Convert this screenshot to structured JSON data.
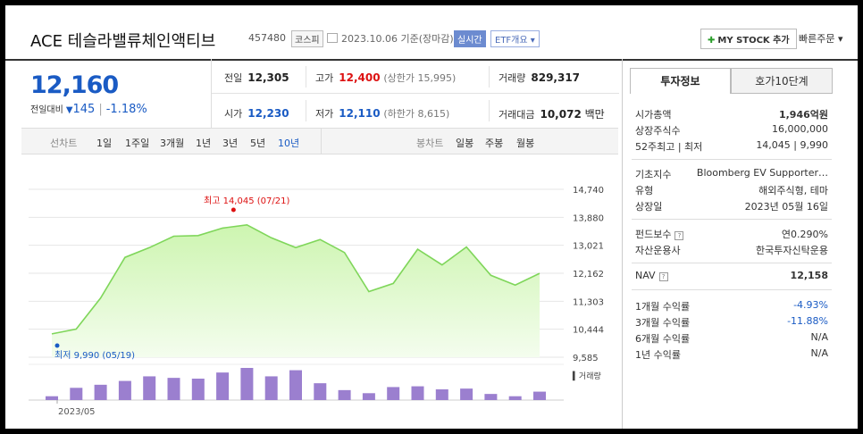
{
  "header": {
    "title": "ACE 테슬라밸류체인액티브",
    "code": "457480",
    "market": "코스피",
    "date": "2023.10.06 기준(장마감)",
    "live_label": "실시간",
    "etf_label": "ETF개요 ▾",
    "mystock_label": "MY STOCK 추가",
    "quick_order": "빠른주문 ▾"
  },
  "quote": {
    "price": "12,160",
    "diff_label": "전일대비",
    "diff_arrow": "▼",
    "diff_value": "145",
    "diff_pct": "-1.18%"
  },
  "grid": {
    "prev_label": "전일",
    "prev": "12,305",
    "high_label": "고가",
    "high": "12,400",
    "upper_limit": "(상한가 15,995)",
    "volume_label": "거래량",
    "volume": "829,317",
    "open_label": "시가",
    "open": "12,230",
    "low_label": "저가",
    "low": "12,110",
    "lower_limit": "(하한가 8,615)",
    "amount_label": "거래대금",
    "amount": "10,072",
    "amount_unit": "백만"
  },
  "period_bar": {
    "line_label": "선차트",
    "line_periods": [
      "1일",
      "1주일",
      "3개월",
      "1년",
      "3년",
      "5년",
      "10년"
    ],
    "active_line_period": "10년",
    "candle_label": "봉차트",
    "candle_periods": [
      "일봉",
      "주봉",
      "월봉"
    ]
  },
  "chart_data": {
    "type": "area",
    "x": [
      "2023-05-19",
      "2023-05-26",
      "2023-06-02",
      "2023-06-09",
      "2023-06-16",
      "2023-06-23",
      "2023-06-30",
      "2023-07-07",
      "2023-07-14",
      "2023-07-21",
      "2023-07-28",
      "2023-08-04",
      "2023-08-11",
      "2023-08-18",
      "2023-08-25",
      "2023-09-01",
      "2023-09-08",
      "2023-09-15",
      "2023-09-22",
      "2023-09-29",
      "2023-10-06"
    ],
    "values": [
      10300,
      10450,
      11400,
      12650,
      12950,
      13300,
      13320,
      13550,
      13650,
      13250,
      12950,
      13200,
      12800,
      11600,
      11850,
      12900,
      12420,
      12970,
      12100,
      11800,
      12160
    ],
    "volume": [
      50,
      160,
      200,
      250,
      310,
      290,
      280,
      360,
      420,
      310,
      390,
      220,
      130,
      90,
      170,
      180,
      140,
      150,
      80,
      50,
      110
    ],
    "yticks": [
      "14,740",
      "13,880",
      "13,021",
      "12,162",
      "11,303",
      "10,444",
      "9,585"
    ],
    "ylim": [
      9585,
      14740
    ],
    "max_label": "최고 14,045 (07/21)",
    "min_label": "최저 9,990 (05/19)",
    "volume_label": "거래량",
    "x_start_label": "2023/05",
    "colors": {
      "area": "#cdf5b0",
      "line": "#7fd65a",
      "volume": "#9b7fcf",
      "max": "#d11",
      "min": "#1a5bc4"
    }
  },
  "right_panel": {
    "tab_info": "투자정보",
    "tab_orderbook": "호가10단계",
    "rows_a": [
      {
        "label": "시가총액",
        "value": "1,946억원"
      },
      {
        "label": "상장주식수",
        "value": "16,000,000"
      },
      {
        "label": "52주최고 | 최저",
        "value": "14,045 | 9,990"
      }
    ],
    "rows_b": [
      {
        "label": "기초지수",
        "value": "Bloomberg EV Supporter…"
      },
      {
        "label": "유형",
        "value": "해외주식형, 테마"
      },
      {
        "label": "상장일",
        "value": "2023년 05월 16일"
      }
    ],
    "rows_c": [
      {
        "label": "펀드보수",
        "value": "연0.290%"
      },
      {
        "label": "자산운용사",
        "value": "한국투자신탁운용"
      }
    ],
    "nav_label": "NAV",
    "nav_value": "12,158",
    "rows_d": [
      {
        "label": "1개월 수익률",
        "value": "-4.93%"
      },
      {
        "label": "3개월 수익률",
        "value": "-11.88%"
      },
      {
        "label": "6개월 수익률",
        "value": "N/A"
      },
      {
        "label": "1년 수익률",
        "value": "N/A"
      }
    ]
  }
}
